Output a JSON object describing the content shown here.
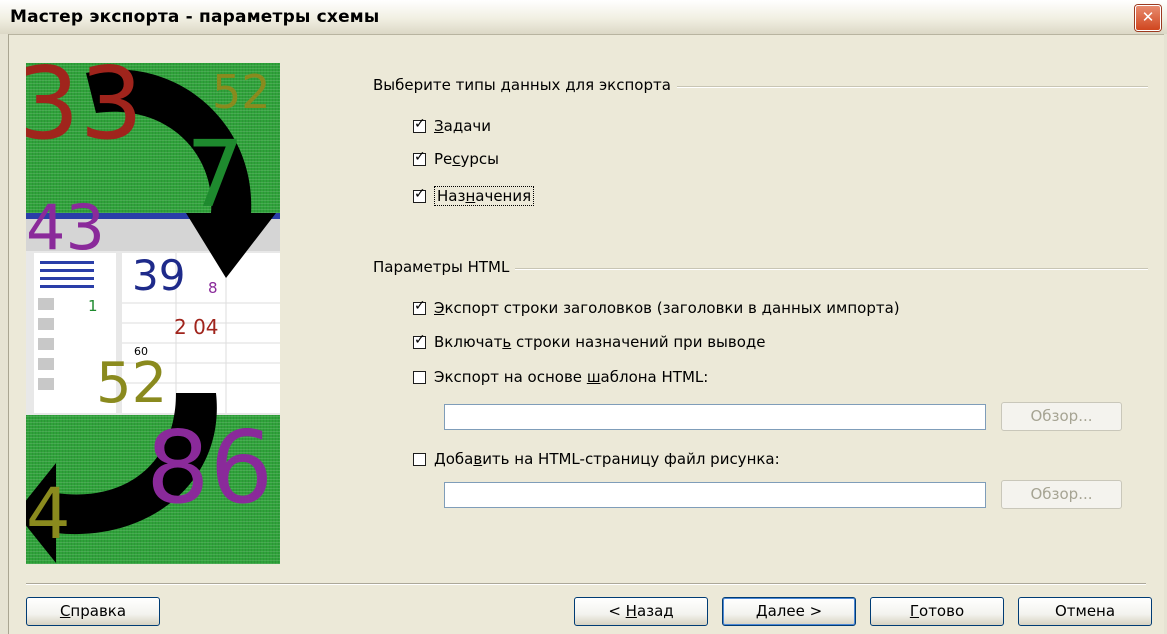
{
  "window": {
    "title": "Мастер экспорта - параметры схемы",
    "close_glyph": "✕"
  },
  "export_types": {
    "legend": "Выберите типы данных для экспорта",
    "items": [
      {
        "pre": "",
        "u": "З",
        "post": "адачи",
        "checked": true
      },
      {
        "pre": "Ре",
        "u": "с",
        "post": "урсы",
        "checked": true
      },
      {
        "pre": "Наз",
        "u": "н",
        "post": "ачения",
        "checked": true
      }
    ]
  },
  "html_params": {
    "legend": "Параметры HTML",
    "items": [
      {
        "pre": "",
        "u": "Э",
        "post": "кспорт строки заголовков (заголовки в данных импорта)",
        "checked": true
      },
      {
        "pre": "Включат",
        "u": "ь",
        "post": " строки назначений при выводе",
        "checked": true
      },
      {
        "pre": "Экспорт на основе ",
        "u": "ш",
        "post": "аблона HTML:",
        "checked": false
      },
      {
        "pre": "Доба",
        "u": "в",
        "post": "ить на HTML-страницу файл рисунка:",
        "checked": false
      }
    ],
    "template_path": "",
    "image_path": "",
    "browse1_label": "Обзор...",
    "browse2_label": "Обзор..."
  },
  "buttons": {
    "help": {
      "u": "С",
      "post": "правка"
    },
    "back": {
      "pre": "< ",
      "u": "Н",
      "post": "азад"
    },
    "next": {
      "u": "Д",
      "post": "алее >"
    },
    "finish": {
      "u": "Г",
      "post": "отово"
    },
    "cancel": "Отмена"
  },
  "illustration": {
    "numbers": [
      "33",
      "52",
      "7",
      "43",
      "39",
      "8",
      "1",
      "2 04",
      "60",
      "52",
      "86",
      "4"
    ]
  }
}
